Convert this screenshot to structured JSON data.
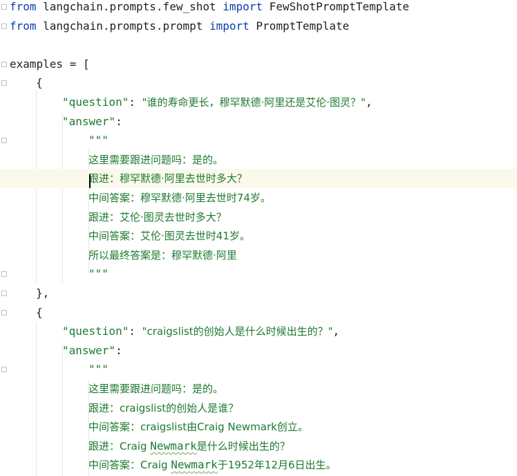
{
  "editor": {
    "lines": [
      {
        "indent": 0,
        "segments": [
          {
            "t": "from",
            "c": "kw"
          },
          {
            "t": " langchain.prompts.few_shot ",
            "c": "ident"
          },
          {
            "t": "import",
            "c": "kw"
          },
          {
            "t": " FewShotPromptTemplate",
            "c": "ident"
          }
        ]
      },
      {
        "indent": 0,
        "segments": [
          {
            "t": "from",
            "c": "kw"
          },
          {
            "t": " langchain.prompts.prompt ",
            "c": "ident"
          },
          {
            "t": "import",
            "c": "kw"
          },
          {
            "t": " PromptTemplate",
            "c": "ident"
          }
        ]
      },
      {
        "indent": 0,
        "segments": []
      },
      {
        "indent": 0,
        "segments": [
          {
            "t": "examples = [",
            "c": "ident"
          }
        ]
      },
      {
        "indent": 1,
        "segments": [
          {
            "t": "{",
            "c": "ident"
          }
        ]
      },
      {
        "indent": 2,
        "segments": [
          {
            "t": "\"question\"",
            "c": "str"
          },
          {
            "t": ": ",
            "c": "ident"
          },
          {
            "t": "\"谁的寿命更长，穆罕默德·阿里还是艾伦·图灵？\"",
            "c": "str"
          },
          {
            "t": ",",
            "c": "ident"
          }
        ]
      },
      {
        "indent": 2,
        "segments": [
          {
            "t": "\"answer\"",
            "c": "str"
          },
          {
            "t": ":",
            "c": "ident"
          }
        ]
      },
      {
        "indent": 3,
        "segments": [
          {
            "t": "\"\"\"",
            "c": "str"
          }
        ]
      },
      {
        "indent": 3,
        "segments": [
          {
            "t": "这里需要跟进问题吗：是的。",
            "c": "str"
          }
        ]
      },
      {
        "indent": 3,
        "current": true,
        "segments": [
          {
            "t": "跟进：穆罕默德·阿里去世时多大？",
            "c": "str"
          }
        ]
      },
      {
        "indent": 3,
        "segments": [
          {
            "t": "中间答案：穆罕默德·阿里去世时74岁。",
            "c": "str"
          }
        ]
      },
      {
        "indent": 3,
        "segments": [
          {
            "t": "跟进：艾伦·图灵去世时多大？",
            "c": "str"
          }
        ]
      },
      {
        "indent": 3,
        "segments": [
          {
            "t": "中间答案：艾伦·图灵去世时41岁。",
            "c": "str"
          }
        ]
      },
      {
        "indent": 3,
        "segments": [
          {
            "t": "所以最终答案是：穆罕默德·阿里",
            "c": "str"
          }
        ]
      },
      {
        "indent": 3,
        "segments": [
          {
            "t": "\"\"\"",
            "c": "str"
          }
        ]
      },
      {
        "indent": 1,
        "segments": [
          {
            "t": "},",
            "c": "ident"
          }
        ]
      },
      {
        "indent": 1,
        "segments": [
          {
            "t": "{",
            "c": "ident"
          }
        ]
      },
      {
        "indent": 2,
        "segments": [
          {
            "t": "\"question\"",
            "c": "str"
          },
          {
            "t": ": ",
            "c": "ident"
          },
          {
            "t": "\"craigslist的创始人是什么时候出生的？\"",
            "c": "str"
          },
          {
            "t": ",",
            "c": "ident"
          }
        ]
      },
      {
        "indent": 2,
        "segments": [
          {
            "t": "\"answer\"",
            "c": "str"
          },
          {
            "t": ":",
            "c": "ident"
          }
        ]
      },
      {
        "indent": 3,
        "segments": [
          {
            "t": "\"\"\"",
            "c": "str"
          }
        ]
      },
      {
        "indent": 3,
        "segments": [
          {
            "t": "这里需要跟进问题吗：是的。",
            "c": "str"
          }
        ]
      },
      {
        "indent": 3,
        "segments": [
          {
            "t": "跟进：craigslist的创始人是谁？",
            "c": "str"
          }
        ]
      },
      {
        "indent": 3,
        "segments": [
          {
            "t": "中间答案：craigslist由Craig Newmark创立。",
            "c": "str"
          }
        ]
      },
      {
        "indent": 3,
        "segments": [
          {
            "t": "跟进：Craig ",
            "c": "str"
          },
          {
            "t": "Newmark",
            "c": "str wavy"
          },
          {
            "t": "是什么时候出生的？",
            "c": "str"
          }
        ]
      },
      {
        "indent": 3,
        "segments": [
          {
            "t": "中间答案：Craig ",
            "c": "str"
          },
          {
            "t": "Newmark",
            "c": "str wavy"
          },
          {
            "t": "于1952年12月6日出生。",
            "c": "str"
          }
        ]
      }
    ]
  }
}
